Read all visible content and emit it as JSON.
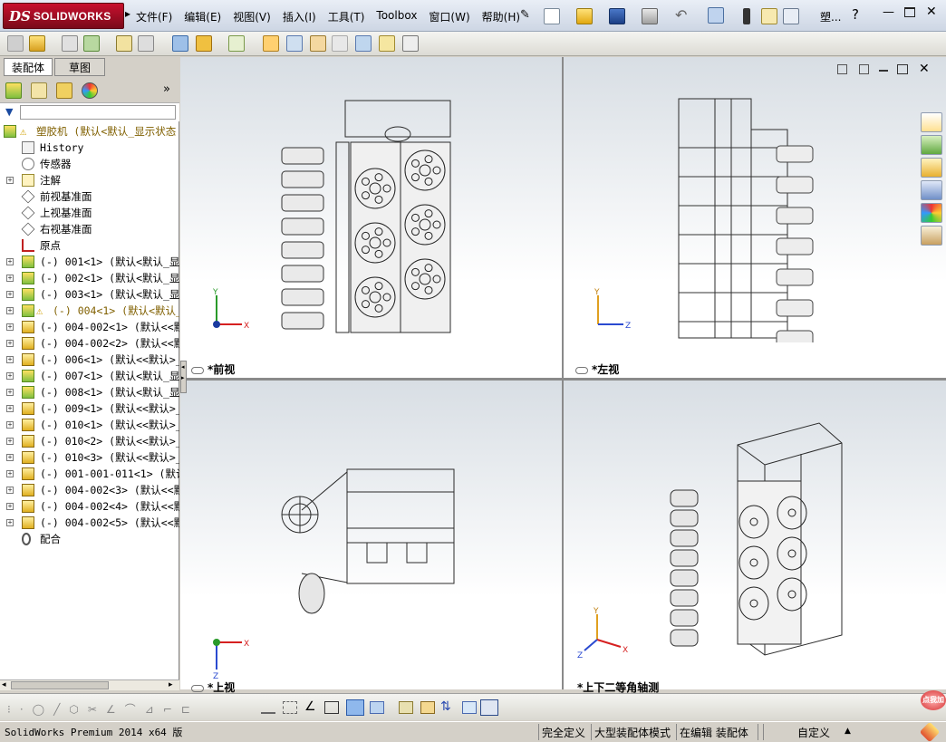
{
  "app": {
    "logo_ds": "DS",
    "logo_text": "SOLIDWORKS",
    "menu": [
      "文件(F)",
      "编辑(E)",
      "视图(V)",
      "插入(I)",
      "工具(T)",
      "Toolbox",
      "窗口(W)",
      "帮助(H)"
    ],
    "right_label": "塑...",
    "accent_color": "#c8102e"
  },
  "left_panel": {
    "tabs": [
      "装配体",
      "草图"
    ],
    "tree": [
      {
        "text": "塑胶机  (默认<默认_显示状态",
        "icon": "assembly-warning-icon",
        "color": "#806000",
        "plus": false
      },
      {
        "text": "History",
        "icon": "history-icon",
        "plus": false
      },
      {
        "text": "传感器",
        "icon": "sensor-icon",
        "plus": false
      },
      {
        "text": "注解",
        "icon": "annotation-icon",
        "plus": true
      },
      {
        "text": "前视基准面",
        "icon": "plane-icon",
        "plus": false
      },
      {
        "text": "上视基准面",
        "icon": "plane-icon",
        "plus": false
      },
      {
        "text": "右视基准面",
        "icon": "plane-icon",
        "plus": false
      },
      {
        "text": "原点",
        "icon": "origin-icon",
        "plus": false
      },
      {
        "text": "(-) 001<1> (默认<默认_显示",
        "icon": "subassembly-icon",
        "plus": true
      },
      {
        "text": "(-) 002<1> (默认<默认_显示",
        "icon": "subassembly-icon",
        "plus": true
      },
      {
        "text": "(-) 003<1> (默认<默认_显示",
        "icon": "subassembly-icon",
        "plus": true
      },
      {
        "text": "(-) 004<1> (默认<默认_显",
        "icon": "subassembly-warning-icon",
        "color": "#806000",
        "plus": true
      },
      {
        "text": "(-) 004-002<1> (默认<<默认",
        "icon": "part-icon",
        "plus": true
      },
      {
        "text": "(-) 004-002<2> (默认<<默认",
        "icon": "part-icon",
        "plus": true
      },
      {
        "text": "(-) 006<1> (默认<<默认>_显",
        "icon": "part-icon",
        "plus": true
      },
      {
        "text": "(-) 007<1> (默认<默认_显示",
        "icon": "subassembly-icon",
        "plus": true
      },
      {
        "text": "(-) 008<1> (默认<默认_显示",
        "icon": "subassembly-icon",
        "plus": true
      },
      {
        "text": "(-) 009<1> (默认<<默认>_显",
        "icon": "part-icon",
        "plus": true
      },
      {
        "text": "(-) 010<1> (默认<<默认>_显",
        "icon": "part-icon",
        "plus": true
      },
      {
        "text": "(-) 010<2> (默认<<默认>_显",
        "icon": "part-icon",
        "plus": true
      },
      {
        "text": "(-) 010<3> (默认<<默认>_显",
        "icon": "part-icon",
        "plus": true
      },
      {
        "text": "(-) 001-001-011<1> (默认<",
        "icon": "part-icon",
        "plus": true
      },
      {
        "text": "(-) 004-002<3> (默认<<默认",
        "icon": "part-icon",
        "plus": true
      },
      {
        "text": "(-) 004-002<4> (默认<<默认",
        "icon": "part-icon",
        "plus": true
      },
      {
        "text": "(-) 004-002<5> (默认<<默认",
        "icon": "part-icon",
        "plus": true
      },
      {
        "text": "配合",
        "icon": "mates-icon",
        "plus": false
      }
    ]
  },
  "viewports": [
    {
      "label": "*前视",
      "axes": [
        "Y",
        "X"
      ]
    },
    {
      "label": "*左视",
      "axes": [
        "Y",
        "Z"
      ]
    },
    {
      "label": "*上视",
      "axes": [
        "X",
        "Z"
      ]
    },
    {
      "label": "*上下二等角轴测",
      "axes": [
        "Y",
        "X",
        "Z"
      ]
    }
  ],
  "status": {
    "version": "SolidWorks Premium 2014 x64 版",
    "constraint": "完全定义",
    "mode": "大型装配体模式",
    "editing": "在编辑 装配体",
    "units": "自定义",
    "promo": "点我加"
  }
}
